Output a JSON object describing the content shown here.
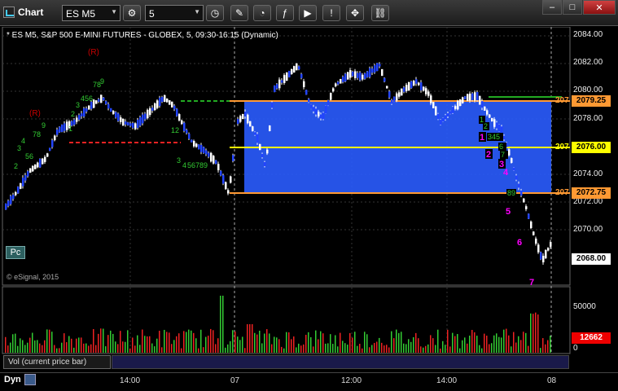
{
  "window": {
    "title": "Chart",
    "minimize": "–",
    "maximize": "□",
    "close": "✕"
  },
  "toolbar": {
    "symbol": "ES M5",
    "interval": "5"
  },
  "chart": {
    "description": "* ES M5, S&P 500 E-MINI FUTURES - GLOBEX, 5, 09:30-16:15 (Dynamic)",
    "copyright": "© eSignal, 2015",
    "pc_button": "Pc",
    "y_ticks": [
      "2084.00",
      "2082.00",
      "2080.00",
      "2078.00",
      "2074.00",
      "2072.00",
      "2070.00"
    ],
    "price_boxes": [
      {
        "label": "2079.25",
        "clip": "207",
        "color": "#ff9933"
      },
      {
        "label": "2076.00",
        "clip": "207",
        "color": "#ffff00"
      },
      {
        "label": "2072.75",
        "clip": "207",
        "color": "#ff9933"
      },
      {
        "label": "2068.00",
        "clip": "",
        "color": "#ffffff"
      }
    ],
    "x_ticks": [
      "14:00",
      "07",
      "12:00",
      "14:00",
      "08"
    ],
    "annotations": {
      "r_labels": [
        "(R)",
        "(R)"
      ],
      "green_counts_a": [
        "2",
        "3",
        "4",
        "56",
        "78",
        "9",
        "1",
        "2",
        "3",
        "4",
        "56",
        "789"
      ],
      "green_counts_b": [
        "12",
        "3",
        "4",
        "56789"
      ],
      "magenta_counts": [
        "1",
        "2",
        "3",
        "4",
        "5",
        "6",
        "7"
      ],
      "green_box_counts": [
        "1",
        "2",
        "3",
        "4",
        "5",
        "6",
        "7",
        "8",
        "9"
      ]
    },
    "colors": {
      "accent_blue": "#2a5cff",
      "magenta": "#ff00ff",
      "orange": "#ff9933",
      "yellow": "#ffff00"
    }
  },
  "volume": {
    "panel_label": "Vol (current price bar)",
    "y_ticks": [
      "50000",
      "0"
    ],
    "current_value": "12662"
  },
  "statusbar": {
    "dyn": "Dyn"
  }
}
